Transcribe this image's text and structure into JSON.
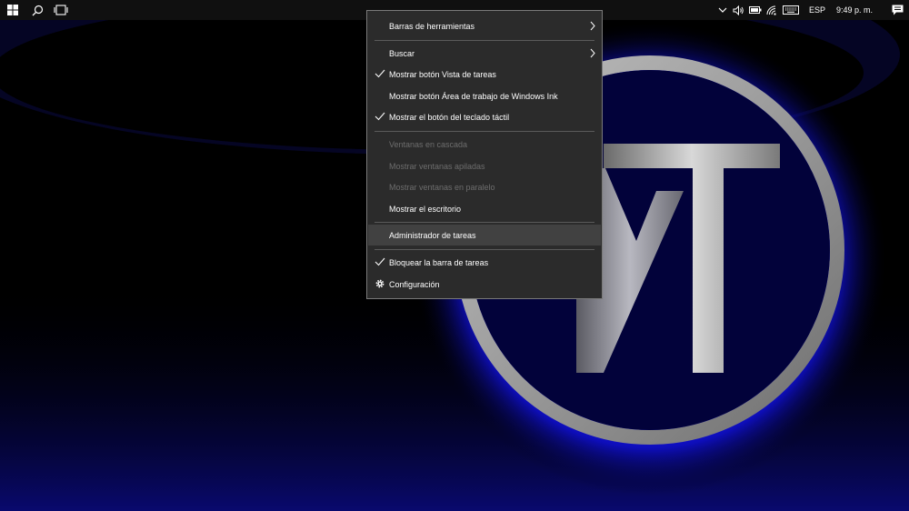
{
  "taskbar": {
    "start_icon": "windows-logo-icon",
    "search_icon": "search-icon",
    "taskview_icon": "task-view-icon",
    "tray": {
      "icons": [
        "chevron-up-icon",
        "volume-icon",
        "battery-icon",
        "wifi-icon",
        "keyboard-icon"
      ],
      "language": "ESP",
      "clock": "9:49 p. m.",
      "notification_icon": "action-center-icon"
    }
  },
  "context_menu": {
    "items": [
      {
        "label": "Barras de herramientas",
        "submenu": true
      },
      {
        "label": "Buscar",
        "submenu": true
      },
      {
        "label": "Mostrar botón Vista de tareas",
        "checked": true
      },
      {
        "label": "Mostrar botón Área de trabajo de Windows Ink"
      },
      {
        "label": "Mostrar el botón del teclado táctil",
        "checked": true
      },
      {
        "label": "Ventanas en cascada",
        "disabled": true
      },
      {
        "label": "Mostrar ventanas apiladas",
        "disabled": true
      },
      {
        "label": "Mostrar ventanas en paralelo",
        "disabled": true
      },
      {
        "label": "Mostrar el escritorio"
      },
      {
        "label": "Administrador de tareas",
        "highlighted": true
      },
      {
        "label": "Bloquear la barra de tareas",
        "checked": true
      },
      {
        "label": "Configuración",
        "icon": "gear-icon"
      }
    ]
  },
  "colors": {
    "menu_bg": "#2b2b2b",
    "menu_border": "#7a7a7a",
    "highlight": "#414141",
    "disabled_text": "#6d6d6d",
    "taskbar_bg": "#101010",
    "glow": "#1a1aff"
  }
}
